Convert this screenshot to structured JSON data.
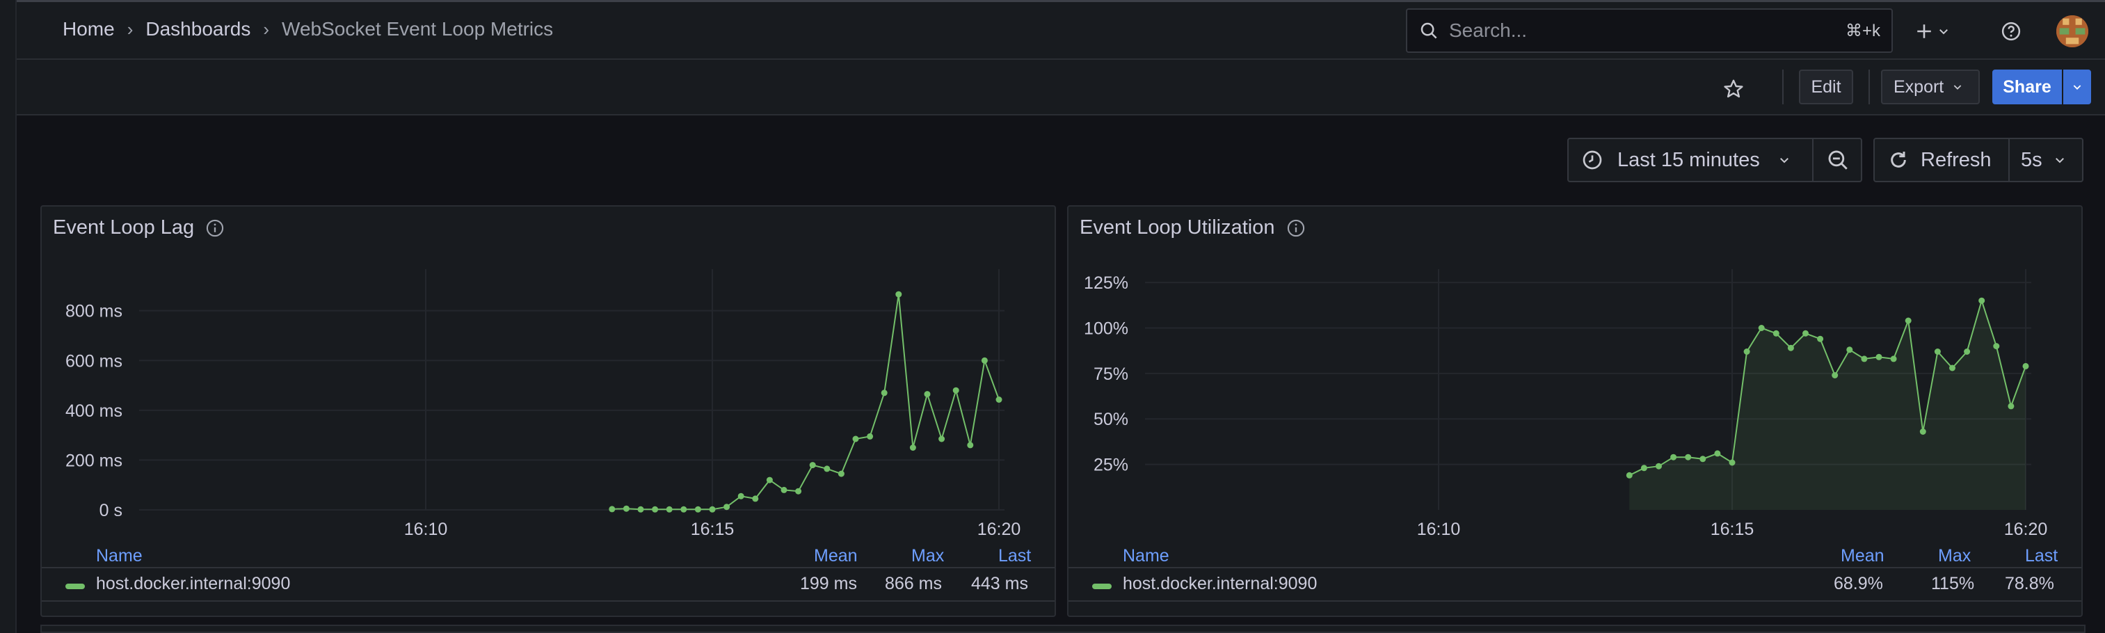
{
  "breadcrumb": {
    "home": "Home",
    "dashboards": "Dashboards",
    "current": "WebSocket Event Loop Metrics"
  },
  "search": {
    "placeholder": "Search...",
    "shortcut": "⌘+k"
  },
  "toolbar": {
    "edit": "Edit",
    "export": "Export",
    "share": "Share"
  },
  "timepicker": {
    "range": "Last 15 minutes",
    "refresh": "Refresh",
    "interval": "5s"
  },
  "colors": {
    "series": "#73bf69",
    "accent": "#3d71d9",
    "legendHeader": "#6e9fff"
  },
  "panels": [
    {
      "title": "Event Loop Lag",
      "legend": {
        "name_header": "Name",
        "mean_header": "Mean",
        "max_header": "Max",
        "last_header": "Last",
        "series_name": "host.docker.internal:9090",
        "mean": "199 ms",
        "max": "866 ms",
        "last": "443 ms"
      }
    },
    {
      "title": "Event Loop Utilization",
      "legend": {
        "name_header": "Name",
        "mean_header": "Mean",
        "max_header": "Max",
        "last_header": "Last",
        "series_name": "host.docker.internal:9090",
        "mean": "68.9%",
        "max": "115%",
        "last": "78.8%"
      }
    }
  ],
  "chart_data": [
    {
      "type": "line",
      "title": "Event Loop Lag",
      "xlabel": "",
      "ylabel": "",
      "xlim": [
        "16:05",
        "16:20"
      ],
      "ylim": [
        0,
        950
      ],
      "yticks": [
        0,
        200,
        400,
        600,
        800
      ],
      "ytick_labels": [
        "0 s",
        "200 ms",
        "400 ms",
        "600 ms",
        "800 ms"
      ],
      "xticks": [
        "16:10",
        "16:15",
        "16:20"
      ],
      "grid": true,
      "fill": false,
      "series": [
        {
          "name": "host.docker.internal:9090",
          "x": [
            "16:13:15",
            "16:13:30",
            "16:13:45",
            "16:14:00",
            "16:14:15",
            "16:14:30",
            "16:14:45",
            "16:15:00",
            "16:15:15",
            "16:15:30",
            "16:15:45",
            "16:16:00",
            "16:16:15",
            "16:16:30",
            "16:16:45",
            "16:17:00",
            "16:17:15",
            "16:17:30",
            "16:17:45",
            "16:18:00",
            "16:18:15",
            "16:18:30",
            "16:18:45",
            "16:19:00",
            "16:19:15",
            "16:19:30",
            "16:19:45",
            "16:20:00"
          ],
          "y": [
            3,
            5,
            2,
            2,
            2,
            2,
            2,
            2,
            12,
            55,
            45,
            120,
            80,
            75,
            180,
            165,
            145,
            285,
            295,
            470,
            866,
            250,
            465,
            285,
            480,
            260,
            600,
            443
          ]
        }
      ]
    },
    {
      "type": "area",
      "title": "Event Loop Utilization",
      "xlabel": "",
      "ylabel": "",
      "xlim": [
        "16:05",
        "16:20"
      ],
      "ylim": [
        0,
        130
      ],
      "yticks": [
        25,
        50,
        75,
        100,
        125
      ],
      "ytick_labels": [
        "25%",
        "50%",
        "75%",
        "100%",
        "125%"
      ],
      "xticks": [
        "16:10",
        "16:15",
        "16:20"
      ],
      "grid": true,
      "fill": true,
      "series": [
        {
          "name": "host.docker.internal:9090",
          "x": [
            "16:13:15",
            "16:13:30",
            "16:13:45",
            "16:14:00",
            "16:14:15",
            "16:14:30",
            "16:14:45",
            "16:15:00",
            "16:15:15",
            "16:15:30",
            "16:15:45",
            "16:16:00",
            "16:16:15",
            "16:16:30",
            "16:16:45",
            "16:17:00",
            "16:17:15",
            "16:17:30",
            "16:17:45",
            "16:18:00",
            "16:18:15",
            "16:18:30",
            "16:18:45",
            "16:19:00",
            "16:19:15",
            "16:19:30",
            "16:19:45",
            "16:20:00"
          ],
          "y": [
            19,
            23,
            24,
            29,
            29,
            28,
            31,
            26,
            87,
            100,
            97,
            89,
            97,
            94,
            74,
            88,
            83,
            84,
            83,
            104,
            43,
            87,
            78,
            87,
            115,
            90,
            57,
            79
          ]
        }
      ]
    }
  ]
}
